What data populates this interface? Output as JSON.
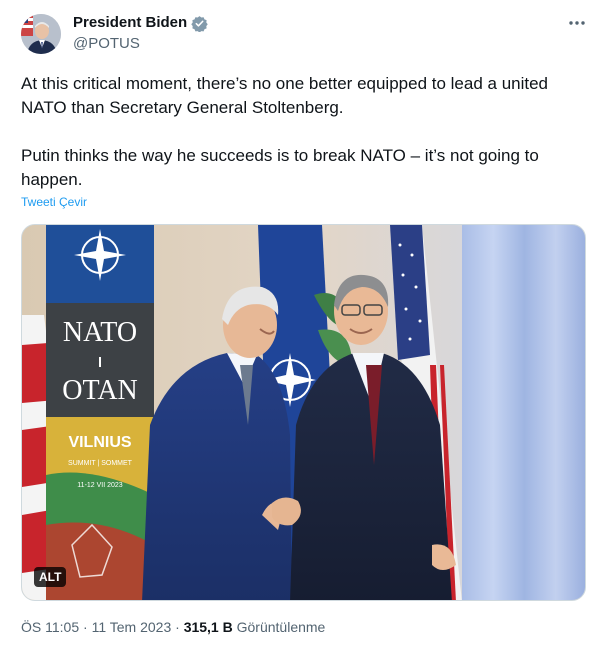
{
  "author": {
    "display_name": "President Biden",
    "handle": "@POTUS",
    "verified_color": "#829aab"
  },
  "tweet": {
    "paragraphs": [
      "At this critical moment, there’s no one better equipped to lead a united NATO than Secretary General Stoltenberg.",
      "Putin thinks the way he succeeds is to break NATO – it’s not going to happen."
    ],
    "translate_label": "Tweeti Çevir"
  },
  "media": {
    "alt_label": "ALT",
    "banner_nato": "NATO",
    "banner_otan": "OTAN",
    "banner_city": "VILNIUS",
    "banner_summit": "SUMMIT | SOMMET",
    "banner_dates": "11-12 VII 2023"
  },
  "meta": {
    "time": "ÖS 11:05",
    "separator": " · ",
    "date": "11 Tem 2023",
    "views_count": "315,1 B",
    "views_label": "Görüntülenme"
  },
  "colors": {
    "accent": "#1d9bf0",
    "muted": "#536471",
    "text": "#0f1419"
  }
}
